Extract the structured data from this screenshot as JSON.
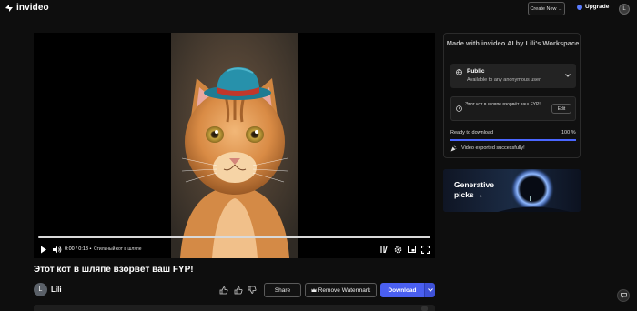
{
  "app": {
    "name": "invideo"
  },
  "header": {
    "create_new_label": "Create New →",
    "upgrade_label": "Upgrade",
    "avatar_initial": "L"
  },
  "player": {
    "time_display": "0:00 / 0:13 •",
    "caption": "Стильный кот в шляпе",
    "progress_fraction": 0.0
  },
  "video": {
    "title": "Этот кот в шляпе взорвёт ваш FYP!",
    "author_initial": "L",
    "author_name": "Lili"
  },
  "actions": {
    "share_label": "Share",
    "remove_watermark_label": "Remove Watermark",
    "download_label": "Download"
  },
  "panel": {
    "title": "Made with invideo AI by Lili's Workspace",
    "visibility_title": "Public",
    "visibility_sub": "Available to any anonymous user",
    "prompt_text": "Этот кот в шляпе взорвёт ваш FYP!",
    "edit_label": "Edit",
    "ready_label": "Ready to download",
    "ready_percent_text": "100 %",
    "ready_fraction": 1.0,
    "export_message": "Video exported successfully!"
  },
  "promo": {
    "line1": "Generative",
    "line2": "picks →"
  },
  "colors": {
    "accent": "#4a5ff0",
    "progress": "#4a66ff",
    "background": "#0e0e0e"
  }
}
